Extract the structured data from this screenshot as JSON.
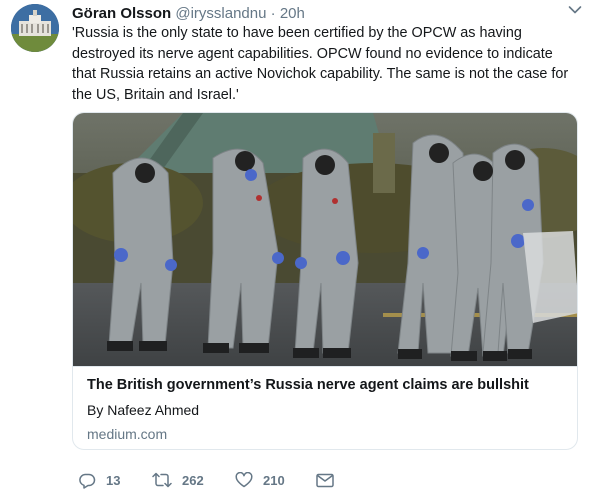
{
  "tweet": {
    "author": {
      "display_name": "Göran Olsson",
      "handle": "@irysslandnu",
      "separator": "·",
      "time": "20h"
    },
    "text": "'Russia is the only state to have been certified by the OPCW as having destroyed its nerve agent capabilities. OPCW found no evidence to indicate that Russia retains an active Novichok capability. The same is not the case for the US, Britain and Israel.'",
    "card": {
      "title": "The British government’s Russia nerve agent claims are bullshit",
      "author": "By Nafeez Ahmed",
      "domain": "medium.com"
    },
    "actions": {
      "reply_count": "13",
      "retweet_count": "262",
      "like_count": "210"
    }
  },
  "icons": {
    "reply": "reply-icon",
    "retweet": "retweet-icon",
    "like": "heart-icon",
    "message": "direct-message-icon",
    "menu": "chevron-down-icon"
  },
  "colors": {
    "text": "#14171a",
    "muted": "#657786",
    "border": "#e1e8ed",
    "suit": "#9aa0a3"
  }
}
